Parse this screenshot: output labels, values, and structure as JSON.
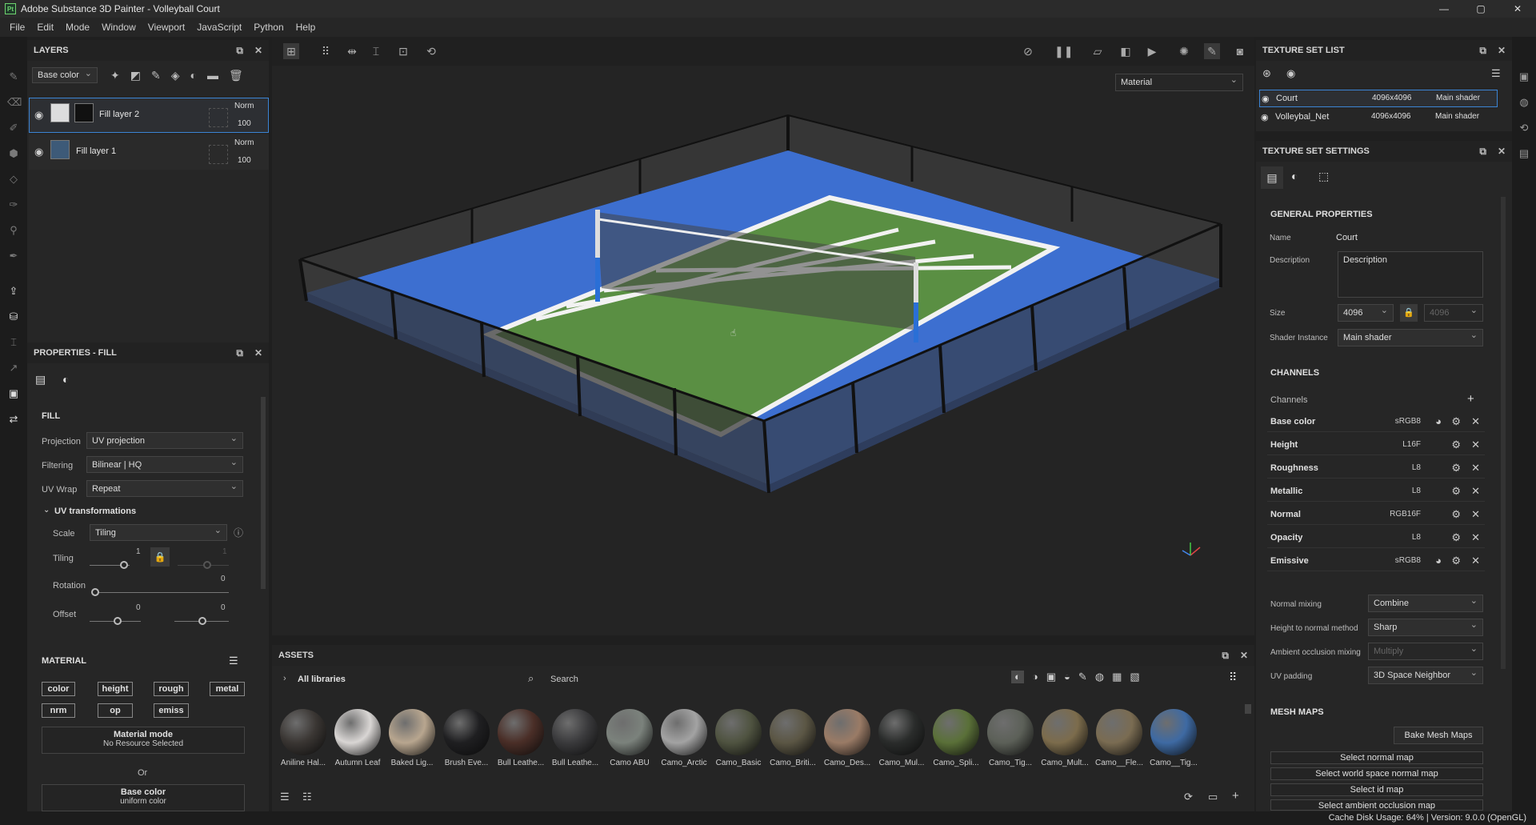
{
  "app": {
    "title": "Adobe Substance 3D Painter - Volleyball Court",
    "logo": "Pt"
  },
  "window_controls": {
    "minimize": "—",
    "maximize": "▢",
    "close": "✕"
  },
  "menu": [
    "File",
    "Edit",
    "Mode",
    "Window",
    "Viewport",
    "JavaScript",
    "Python",
    "Help"
  ],
  "layers": {
    "title": "LAYERS",
    "channel_select": "Base color",
    "items": [
      {
        "name": "Fill layer 2",
        "blend": "Norm",
        "opacity": "100",
        "selected": true
      },
      {
        "name": "Fill layer 1",
        "blend": "Norm",
        "opacity": "100",
        "selected": false
      }
    ]
  },
  "properties": {
    "title": "PROPERTIES - FILL",
    "fill_header": "FILL",
    "projection_label": "Projection",
    "projection_value": "UV projection",
    "filtering_label": "Filtering",
    "filtering_value": "Bilinear | HQ",
    "uvwrap_label": "UV Wrap",
    "uvwrap_value": "Repeat",
    "uv_transform_header": "UV transformations",
    "scale_label": "Scale",
    "scale_value": "Tiling",
    "tiling_label": "Tiling",
    "tiling_value_1": "1",
    "tiling_value_2": "1",
    "rotation_label": "Rotation",
    "rotation_value": "0",
    "offset_label": "Offset",
    "offset_value_1": "0",
    "offset_value_2": "0",
    "material_header": "MATERIAL",
    "channels": [
      "color",
      "height",
      "rough",
      "metal",
      "nrm",
      "op",
      "emiss"
    ],
    "material_mode_title": "Material mode",
    "material_mode_sub": "No Resource Selected",
    "or_text": "Or",
    "base_color_title": "Base color",
    "base_color_sub": "uniform color"
  },
  "viewport": {
    "mode_select": "Material"
  },
  "texture_set_list": {
    "title": "TEXTURE SET LIST",
    "sets": [
      {
        "name": "Court",
        "size": "4096x4096",
        "shader": "Main shader",
        "selected": true
      },
      {
        "name": "Volleybal_Net",
        "size": "4096x4096",
        "shader": "Main shader",
        "selected": false
      }
    ]
  },
  "texture_set_settings": {
    "title": "TEXTURE SET SETTINGS",
    "general_header": "GENERAL PROPERTIES",
    "name_label": "Name",
    "name_value": "Court",
    "description_label": "Description",
    "description_value": "Description",
    "size_label": "Size",
    "size_value": "4096",
    "size_value_2": "4096",
    "shader_label": "Shader Instance",
    "shader_value": "Main shader",
    "channels_header": "CHANNELS",
    "channels_label": "Channels",
    "channels": [
      {
        "name": "Base color",
        "format": "sRGB8",
        "has_color": true
      },
      {
        "name": "Height",
        "format": "L16F",
        "has_color": false
      },
      {
        "name": "Roughness",
        "format": "L8",
        "has_color": false
      },
      {
        "name": "Metallic",
        "format": "L8",
        "has_color": false
      },
      {
        "name": "Normal",
        "format": "RGB16F",
        "has_color": false
      },
      {
        "name": "Opacity",
        "format": "L8",
        "has_color": false
      },
      {
        "name": "Emissive",
        "format": "sRGB8",
        "has_color": true
      }
    ],
    "normal_mixing_label": "Normal mixing",
    "normal_mixing_value": "Combine",
    "height_normal_label": "Height to normal method",
    "height_normal_value": "Sharp",
    "ao_mixing_label": "Ambient occlusion mixing",
    "ao_mixing_value": "Multiply",
    "uv_padding_label": "UV padding",
    "uv_padding_value": "3D Space Neighbor",
    "mesh_maps_header": "MESH MAPS",
    "bake_button": "Bake Mesh Maps",
    "mesh_map_buttons": [
      "Select normal map",
      "Select world space normal map",
      "Select id map",
      "Select ambient occlusion map"
    ]
  },
  "assets": {
    "title": "ASSETS",
    "library": "All libraries",
    "search_placeholder": "Search",
    "materials": [
      {
        "label": "Aniline Hal...",
        "color": "#3a3633"
      },
      {
        "label": "Autumn Leaf",
        "color": "#d9d6d4"
      },
      {
        "label": "Baked Lig...",
        "color": "#b8a68f"
      },
      {
        "label": "Brush Eve...",
        "color": "#1f1f21"
      },
      {
        "label": "Bull Leathe...",
        "color": "#4a2e27"
      },
      {
        "label": "Bull Leathe...",
        "color": "#3a3a3c"
      },
      {
        "label": "Camo ABU",
        "color": "#7b827c"
      },
      {
        "label": "Camo_Arctic",
        "color": "#a3a3a3"
      },
      {
        "label": "Camo_Basic",
        "color": "#4f5340"
      },
      {
        "label": "Camo_Briti...",
        "color": "#5b5644"
      },
      {
        "label": "Camo_Des...",
        "color": "#9a7b66"
      },
      {
        "label": "Camo_Mul...",
        "color": "#2a2c2b"
      },
      {
        "label": "Camo_Spli...",
        "color": "#5a7038"
      },
      {
        "label": "Camo_Tig...",
        "color": "#5c6058"
      },
      {
        "label": "Camo_Mult...",
        "color": "#7c6c4c"
      },
      {
        "label": "Camo__Fle...",
        "color": "#7a6c52"
      },
      {
        "label": "Camo__Tig...",
        "color": "#3e6aa3"
      }
    ]
  },
  "status": {
    "text": "Cache Disk Usage:   64% | Version: 9.0.0 (OpenGL)"
  },
  "colors": {
    "accent": "#3b84d4",
    "court_green": "#5a8f43",
    "court_blue": "#3d6fd0"
  }
}
